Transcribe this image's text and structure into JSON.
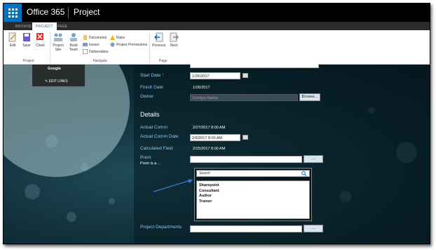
{
  "suite": {
    "brand": "Office 365",
    "app_title": "Project"
  },
  "tabs": [
    {
      "label": "BROWSE"
    },
    {
      "label": "PROJECT"
    },
    {
      "label": "PAGE"
    }
  ],
  "ribbon": {
    "edit": "Edit",
    "save": "Save",
    "close": "Close",
    "project_site": "Project Site",
    "build_team": "Build Team",
    "documents": "Documents",
    "issues": "Issues",
    "deliverables": "Deliverables",
    "risks": "Risks",
    "project_permissions": "Project Permissions",
    "previous": "Previous",
    "next": "Next",
    "group_project": "Project",
    "group_navigate": "Navigate",
    "group_page": "Page"
  },
  "sidebar": {
    "google": "Google",
    "edit_links": "EDIT LINKS"
  },
  "form": {
    "start_date_label": "Start Date",
    "required_mark": "*",
    "start_date_value": "1/26/2017",
    "finish_date_label": "Finish Date",
    "finish_date_value": "1/26/2017",
    "owner_label": "Owner",
    "owner_value": "Srividya Nakka",
    "browse": "Browse...",
    "details_heading": "Details",
    "actual_comm_label": "Actual Comm",
    "actual_comm_value": "2/27/2017 8:00 AM",
    "actual_comm_date_label": "Actual Comm Date",
    "actual_comm_date_value": "2/6/2017 8:00 AM",
    "calculated_field_label": "Calculated Field",
    "calculated_field_value": "2/25/2017 8:00 AM",
    "prem_label": "Prem",
    "prem_desc": "Prem is a ...",
    "ellipsis": "...",
    "search_placeholder": "Search",
    "options": [
      "Sharepoint",
      "Consultant",
      "Author",
      "Trainer"
    ],
    "project_departments_label": "Project Departments"
  },
  "colors": {
    "accent": "#0072c6",
    "label": "#8fc8e8",
    "arrow": "#3b7bd4"
  }
}
